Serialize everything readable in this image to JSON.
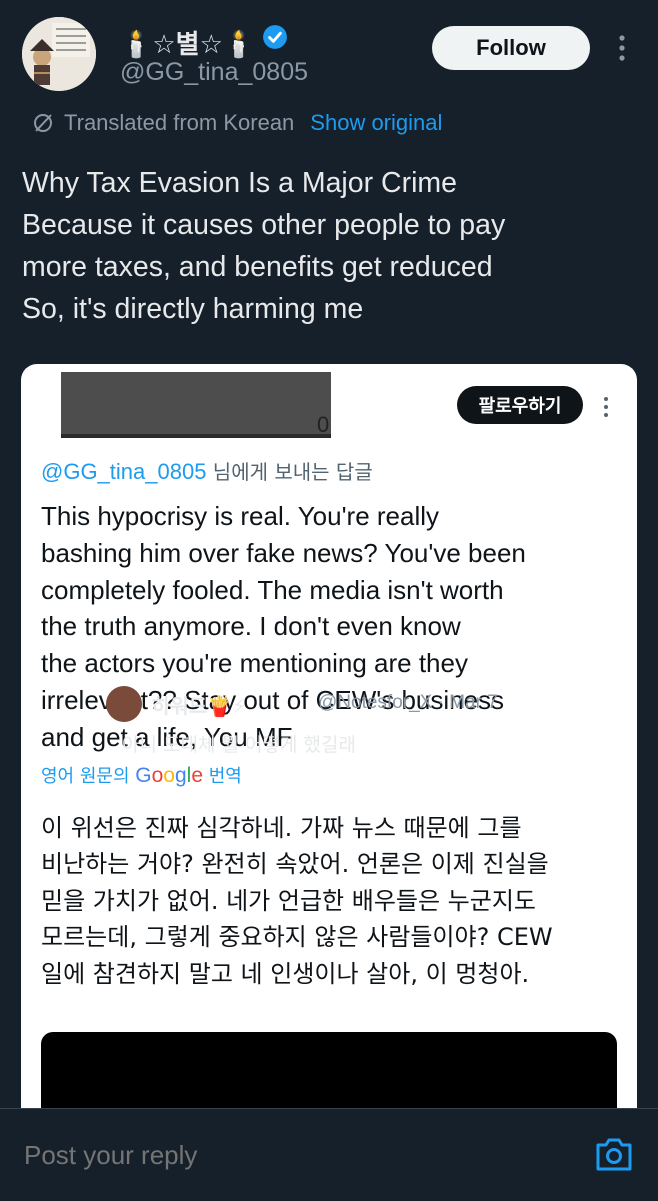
{
  "author": {
    "display_name": "🕯️☆별☆🕯️",
    "handle": "@GG_tina_0805",
    "avatar_icon": "avatar-illustration",
    "verified_icon": "verified-badge-icon"
  },
  "follow_label": "Follow",
  "translation": {
    "label": "Translated from Korean",
    "show_original": "Show original"
  },
  "tweet_lines": [
    "Why Tax Evasion Is a Major Crime",
    "Because it causes other people to pay",
    "more taxes, and benefits get reduced",
    "So, it's directly harming me"
  ],
  "screenshot": {
    "follow_label": "팔로우하기",
    "redacted_tail": "0",
    "reply_mention": "@GG_tina_0805",
    "reply_suffix": " 님에게 보내는 답글",
    "body_lines": [
      "This hypocrisy is real. You're really",
      "bashing him over fake news? You've been",
      "completely fooled. The media isn't worth",
      "the truth anymore. I don't even know",
      "the actors you're mentioning are they",
      "irrelevant??  Stay out of CEW's business",
      "and get a life, You MF"
    ],
    "google_translate": {
      "prefix": "영어 원문의 ",
      "google": "Google",
      "suffix": " 번역"
    },
    "korean_lines": [
      "이 위선은 진짜 심각하네. 가짜 뉴스 때문에 그를",
      "비난하는 거야? 완전히 속았어. 언론은 이제 진실을",
      "믿을 가치가 없어. 네가 언급한 배우들은 누군지도",
      "모르는데, 그렇게 중요하지 않은 사람들이야? CEW",
      "일에 참견하지 말고 네 인생이나 살아, 이 멍청아."
    ],
    "quoted": {
      "name": "하워드🍟⚡",
      "handle": "@Notesfor_X · Mar 7",
      "text": "아니 도대체 뭘 어떻게 했길래"
    }
  },
  "reply": {
    "placeholder": "Post your reply"
  },
  "colors": {
    "background": "#15202b",
    "accent": "#1d9bf0",
    "text": "#e7e9ea",
    "muted": "#8b98a5"
  }
}
